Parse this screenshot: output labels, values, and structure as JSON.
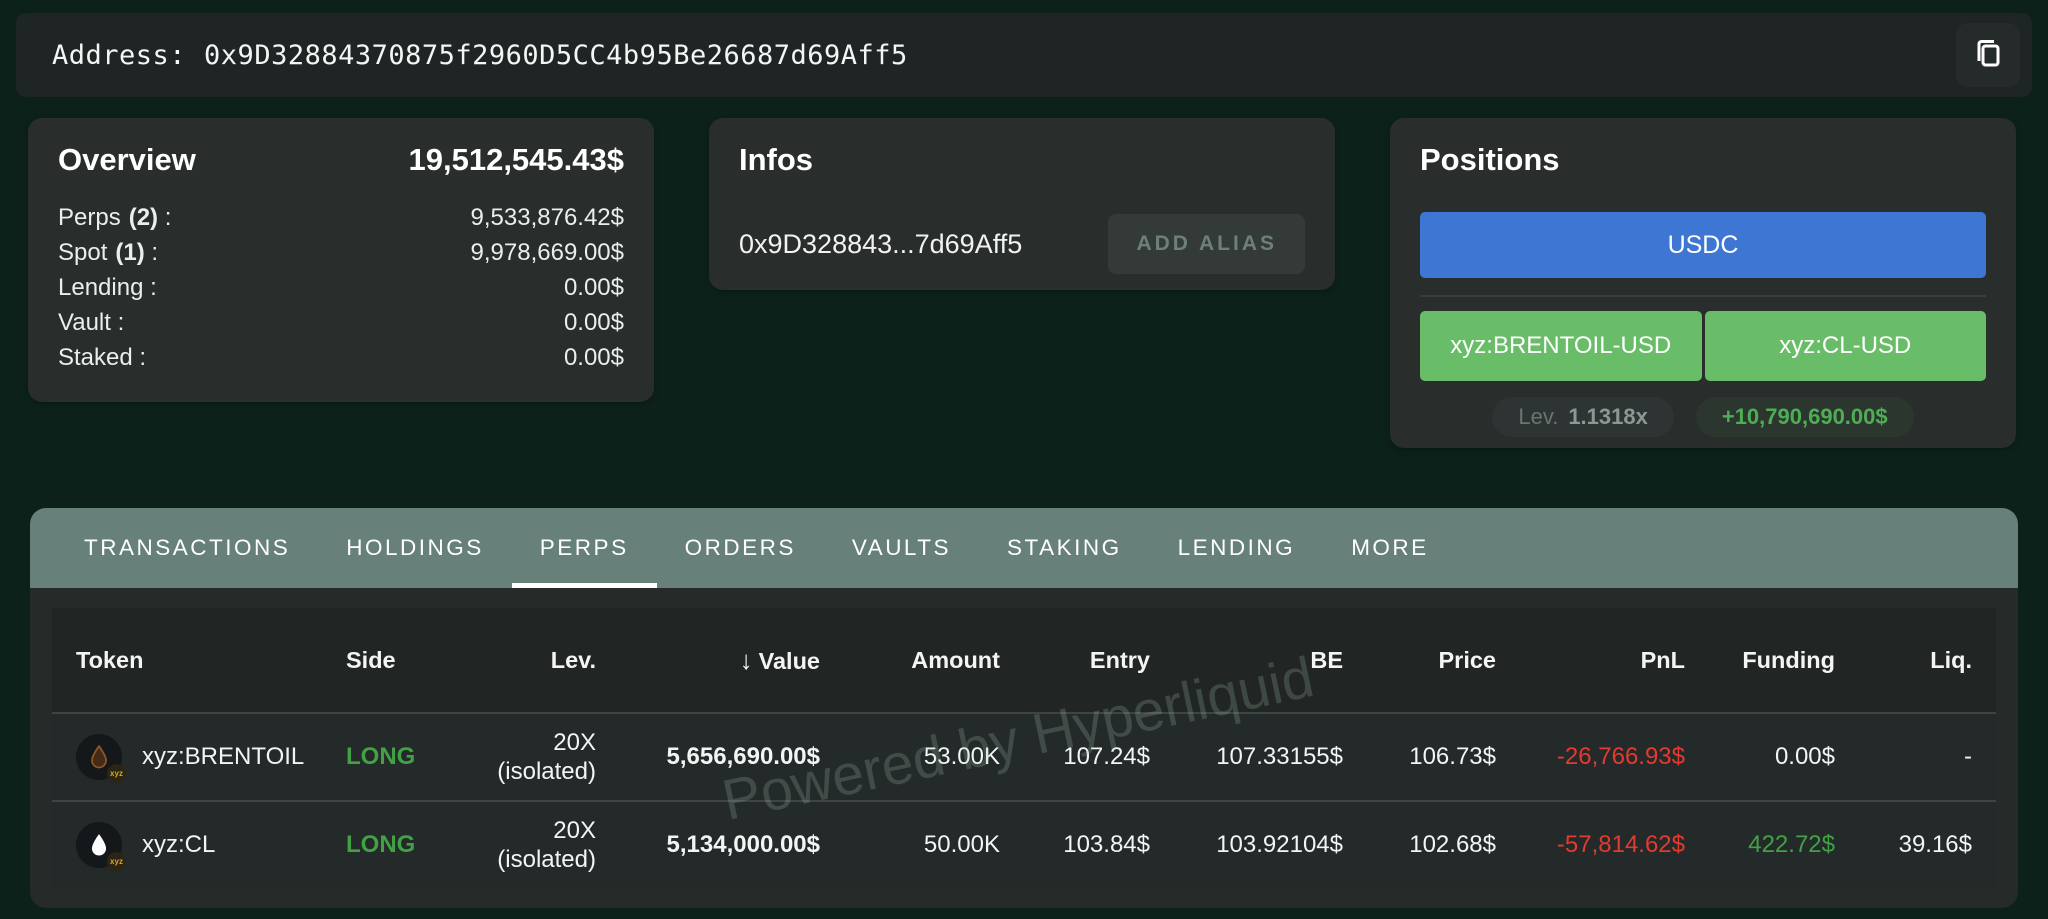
{
  "address_bar": {
    "label": "Address:",
    "value": "0x9D32884370875f2960D5CC4b95Be26687d69Aff5"
  },
  "overview": {
    "title": "Overview",
    "total": "19,512,545.43$",
    "rows": [
      {
        "prefix": "Perps",
        "count": "(2)",
        "suffix": " :",
        "value": "9,533,876.42$"
      },
      {
        "prefix": "Spot",
        "count": "(1)",
        "suffix": " :",
        "value": "9,978,669.00$"
      },
      {
        "prefix": "Lending",
        "count": "",
        "suffix": " :",
        "value": "0.00$"
      },
      {
        "prefix": "Vault",
        "count": "",
        "suffix": " :",
        "value": "0.00$"
      },
      {
        "prefix": "Staked",
        "count": "",
        "suffix": " :",
        "value": "0.00$"
      }
    ]
  },
  "infos": {
    "title": "Infos",
    "address_short": "0x9D328843...7d69Aff5",
    "add_alias": "ADD ALIAS"
  },
  "positions": {
    "title": "Positions",
    "spot_token": "USDC",
    "markets": [
      "xyz:BRENTOIL-USD",
      "xyz:CL-USD"
    ],
    "lev_label": "Lev.",
    "lev_value": "1.1318x",
    "upnl": "+10,790,690.00$"
  },
  "tabs": {
    "items": [
      "TRANSACTIONS",
      "HOLDINGS",
      "PERPS",
      "ORDERS",
      "VAULTS",
      "STAKING",
      "LENDING",
      "MORE"
    ],
    "active": "PERPS"
  },
  "table": {
    "sort_indicator": "↓",
    "columns": [
      "Token",
      "Side",
      "Lev.",
      "Value",
      "Amount",
      "Entry",
      "BE",
      "Price",
      "PnL",
      "Funding",
      "Liq."
    ],
    "rows": [
      {
        "token": "xyz:BRENTOIL",
        "icon": "oil-drop-dark-icon",
        "icon_badge": "xyz",
        "side": "LONG",
        "lev": "20X",
        "lev_mode": "(isolated)",
        "value": "5,656,690.00$",
        "amount": "53.00K",
        "entry": "107.24$",
        "be": "107.33155$",
        "price": "106.73$",
        "pnl": "-26,766.93$",
        "funding": "0.00$",
        "liq": "-"
      },
      {
        "token": "xyz:CL",
        "icon": "oil-drop-white-icon",
        "icon_badge": "xyz",
        "side": "LONG",
        "lev": "20X",
        "lev_mode": "(isolated)",
        "value": "5,134,000.00$",
        "amount": "50.00K",
        "entry": "103.84$",
        "be": "103.92104$",
        "price": "102.68$",
        "pnl": "-57,814.62$",
        "funding": "422.72$",
        "liq": "39.16$"
      }
    ]
  },
  "watermark": {
    "text": "Powered by Hyperliquid"
  },
  "colors": {
    "page_bg": "#0d211b",
    "card_bg": "#292e2d",
    "tab_bar": "#68807a",
    "accent_blue": "#3d77d3",
    "accent_green_button": "#6abd68",
    "long_green": "#43a145",
    "loss_red": "#e23b30",
    "funding_green": "#43a145",
    "badge_pnl_green": "#4fae55",
    "icon_badge_gold": "#d4a92a"
  }
}
